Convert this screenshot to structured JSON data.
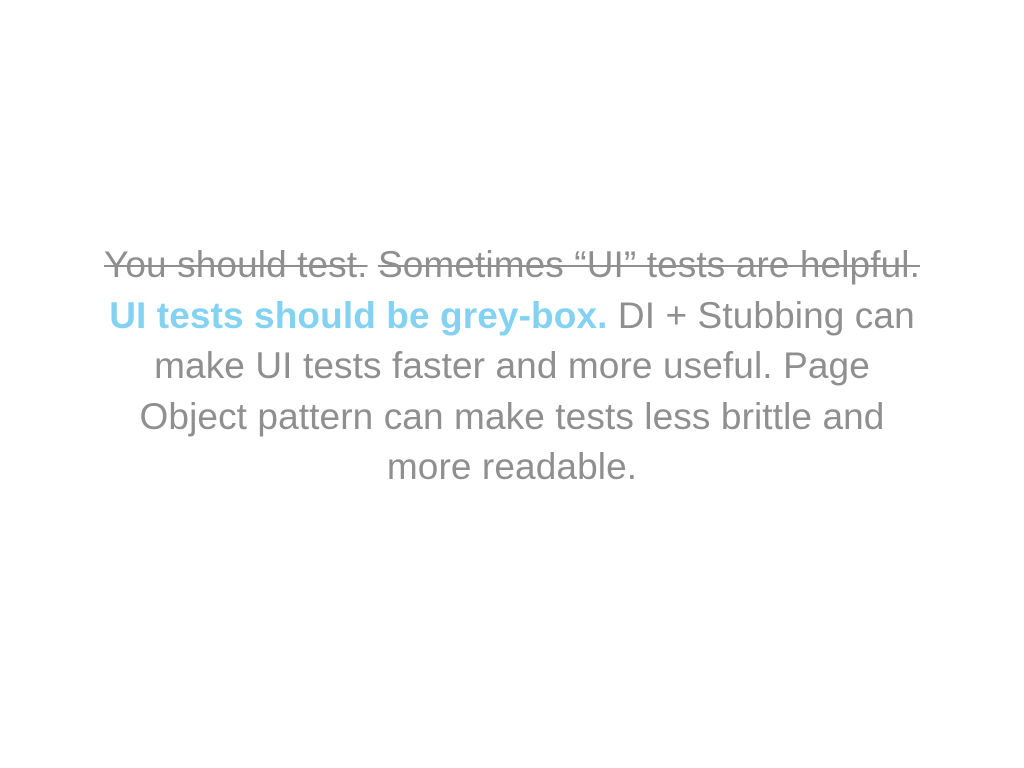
{
  "slide": {
    "struck_sentence_1": "You should test.",
    "struck_sentence_2": "Sometimes “UI” tests are helpful.",
    "highlight_sentence": "UI tests should be grey-box.",
    "sentence_3": "DI + Stubbing can make UI tests faster and more useful.",
    "sentence_4": "Page Object pattern can make tests less brittle and more readable.",
    "colors": {
      "text": "#8f8f8f",
      "highlight": "#84d2f1",
      "background": "#ffffff"
    }
  }
}
